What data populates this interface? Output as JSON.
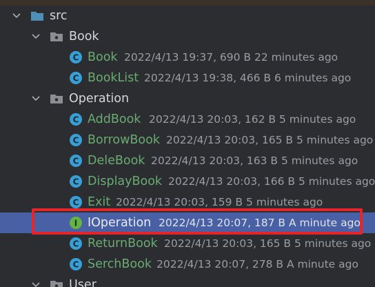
{
  "tree": {
    "root": {
      "label": "src"
    },
    "book_folder": {
      "label": "Book"
    },
    "book_files": [
      {
        "name": "Book",
        "meta": "2022/4/13 19:37, 690 B 22 minutes ago"
      },
      {
        "name": "BookList",
        "meta": "2022/4/13 19:38, 466 B 6 minutes ago"
      }
    ],
    "operation_folder": {
      "label": "Operation"
    },
    "operation_files": [
      {
        "name": "AddBook",
        "meta": "2022/4/13 20:03, 162 B 5 minutes ago",
        "kind": "class"
      },
      {
        "name": "BorrowBook",
        "meta": "2022/4/13 20:03, 165 B 5 minutes ago",
        "kind": "class"
      },
      {
        "name": "DeleBook",
        "meta": "2022/4/13 20:03, 163 B 5 minutes ago",
        "kind": "class"
      },
      {
        "name": "DisplayBook",
        "meta": "2022/4/13 20:03, 166 B 5 minutes ago",
        "kind": "class"
      },
      {
        "name": "Exit",
        "meta": "2022/4/13 20:03, 159 B 5 minutes ago",
        "kind": "class"
      },
      {
        "name": "IOperation",
        "meta": "2022/4/13 20:07, 187 B A minute ago",
        "kind": "interface"
      },
      {
        "name": "ReturnBook",
        "meta": "2022/4/13 20:03, 165 B 5 minutes ago",
        "kind": "class"
      },
      {
        "name": "SerchBook",
        "meta": "2022/4/13 20:07, 278 B A minute ago",
        "kind": "class"
      }
    ],
    "user_folder": {
      "label": "User"
    }
  },
  "icons": {
    "class_icon": {
      "letter": "C",
      "color": "#389fd6"
    },
    "interface_icon": {
      "letter": "I",
      "color": "#62b543"
    }
  },
  "colors": {
    "background": "#2b2d30",
    "selection": "#4a60a5",
    "highlight_border": "#e6252a",
    "file_name": "#6aab73"
  }
}
